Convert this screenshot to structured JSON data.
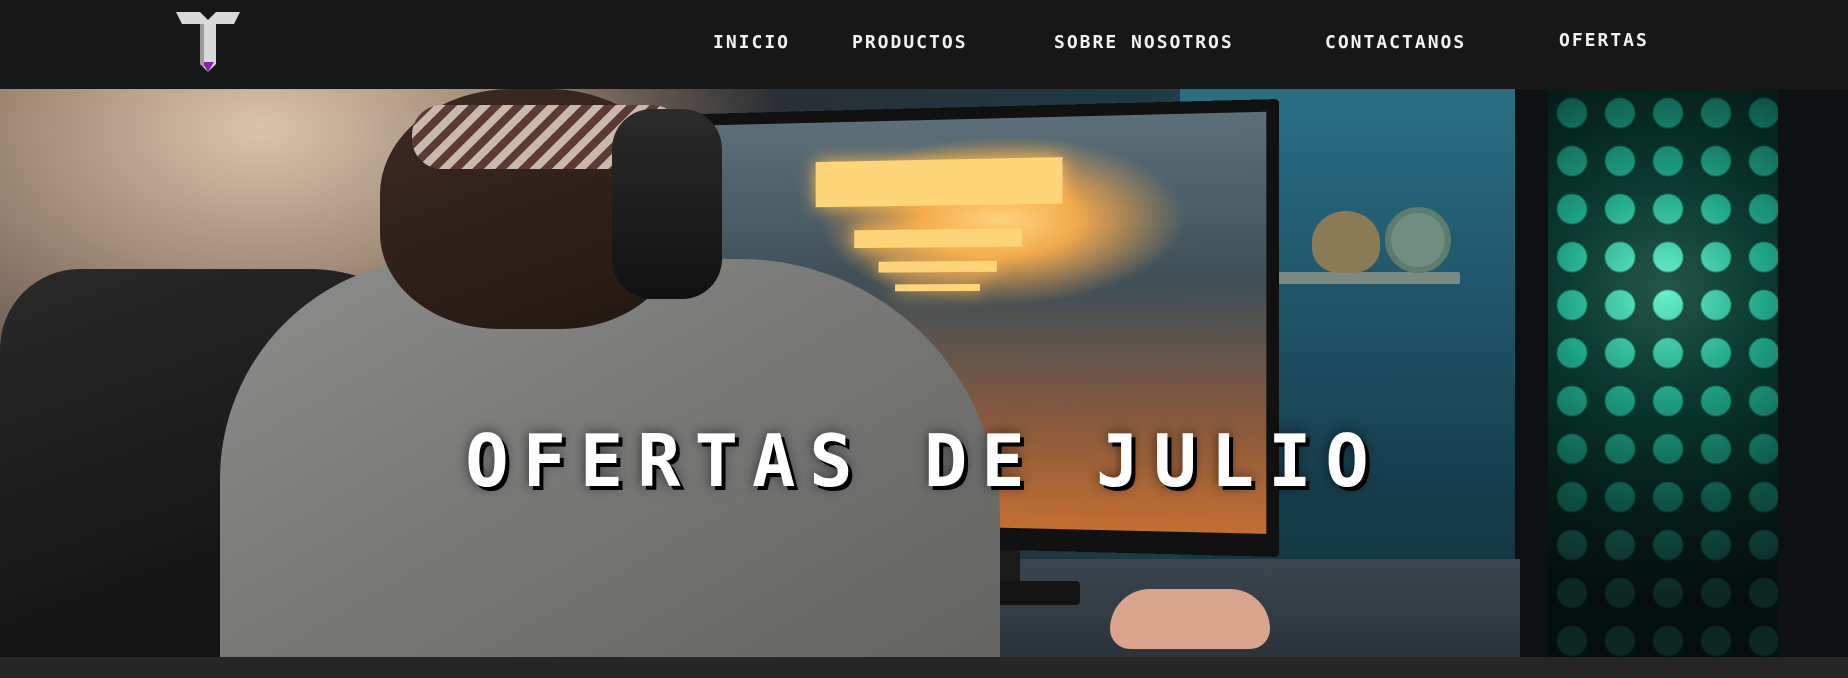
{
  "header": {
    "logo_icon": "tt-brand-logo-icon",
    "nav": [
      {
        "label": "INICIO"
      },
      {
        "label": "PRODUCTOS"
      },
      {
        "label": "SOBRE NOSOTROS"
      },
      {
        "label": "CONTACTANOS"
      },
      {
        "label": "OFERTAS"
      }
    ]
  },
  "hero": {
    "title": "OFERTAS DE JULIO"
  },
  "colors": {
    "navbar_bg": "#171717",
    "nav_text": "#f2f2f2",
    "logo_accent": "#8a1fb0"
  }
}
